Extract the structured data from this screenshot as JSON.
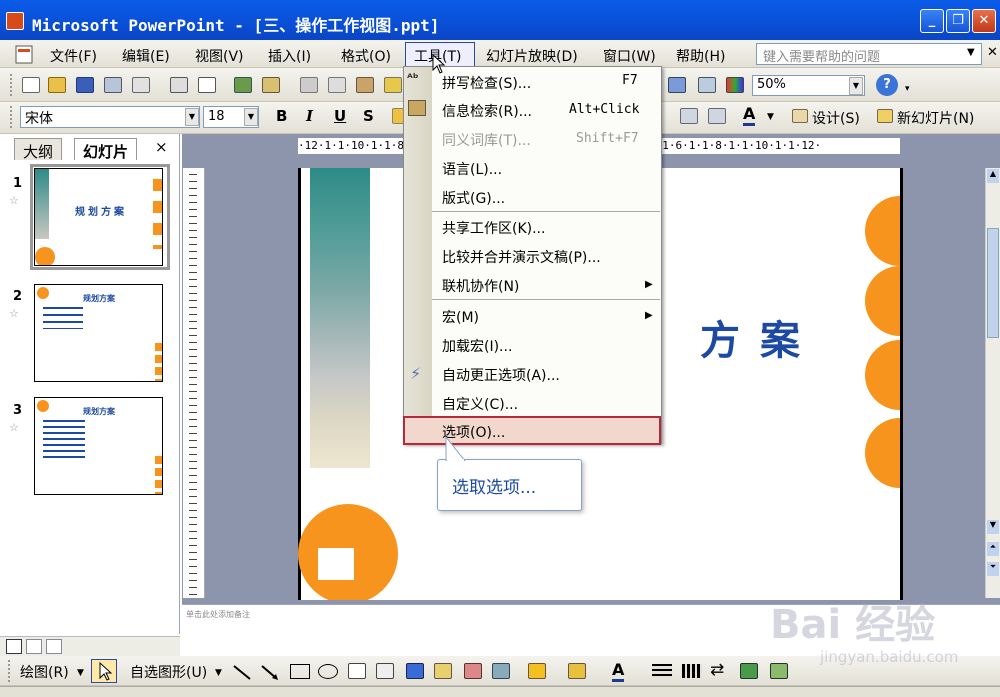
{
  "app": {
    "title": "Microsoft PowerPoint - [三、操作工作视图.ppt]"
  },
  "menubar": {
    "items": [
      "文件(F)",
      "编辑(E)",
      "视图(V)",
      "插入(I)",
      "格式(O)",
      "工具(T)",
      "幻灯片放映(D)",
      "窗口(W)",
      "帮助(H)"
    ],
    "help_placeholder": "键入需要帮助的问题"
  },
  "format_toolbar": {
    "font": "宋体",
    "size": "18",
    "bold": "B",
    "italic": "I",
    "underline": "U",
    "shadow": "S",
    "design_label": "设计(S)",
    "new_slide_label": "新幻灯片(N)"
  },
  "standard_toolbar": {
    "zoom": "50%"
  },
  "leftpane": {
    "tabs": [
      "大纲",
      "幻灯片"
    ],
    "close": "×",
    "slides": [
      {
        "num": "1",
        "title": "规划方案"
      },
      {
        "num": "2",
        "title": "规划方案"
      },
      {
        "num": "3",
        "title": "规划方案"
      }
    ]
  },
  "slide": {
    "title_partial": "方案"
  },
  "tools_menu": {
    "items": [
      {
        "label": "拼写检查(S)...",
        "shortcut": "F7"
      },
      {
        "label": "信息检索(R)...",
        "shortcut": "Alt+Click"
      },
      {
        "label": "同义词库(T)...",
        "shortcut": "Shift+F7",
        "disabled": true
      },
      {
        "label": "语言(L)..."
      },
      {
        "label": "版式(G)..."
      },
      {
        "label": "共享工作区(K)..."
      },
      {
        "label": "比较并合并演示文稿(P)..."
      },
      {
        "label": "联机协作(N)",
        "submenu": true
      },
      {
        "label": "宏(M)",
        "submenu": true
      },
      {
        "label": "加载宏(I)..."
      },
      {
        "label": "自动更正选项(A)..."
      },
      {
        "label": "自定义(C)..."
      },
      {
        "label": "选项(O)..."
      }
    ]
  },
  "callout": {
    "text": "选取选项..."
  },
  "drawbar": {
    "draw_label": "绘图(R)",
    "autoshape_label": "自选图形(U)"
  },
  "notes": {
    "placeholder": "单击此处添加备注"
  },
  "watermark": {
    "text": "Bai 经验",
    "url": "jingyan.baidu.com"
  },
  "colors": {
    "accent": "#f7941d",
    "slide_teal": "#2e8b88",
    "title_blue": "#1c4aa3"
  }
}
